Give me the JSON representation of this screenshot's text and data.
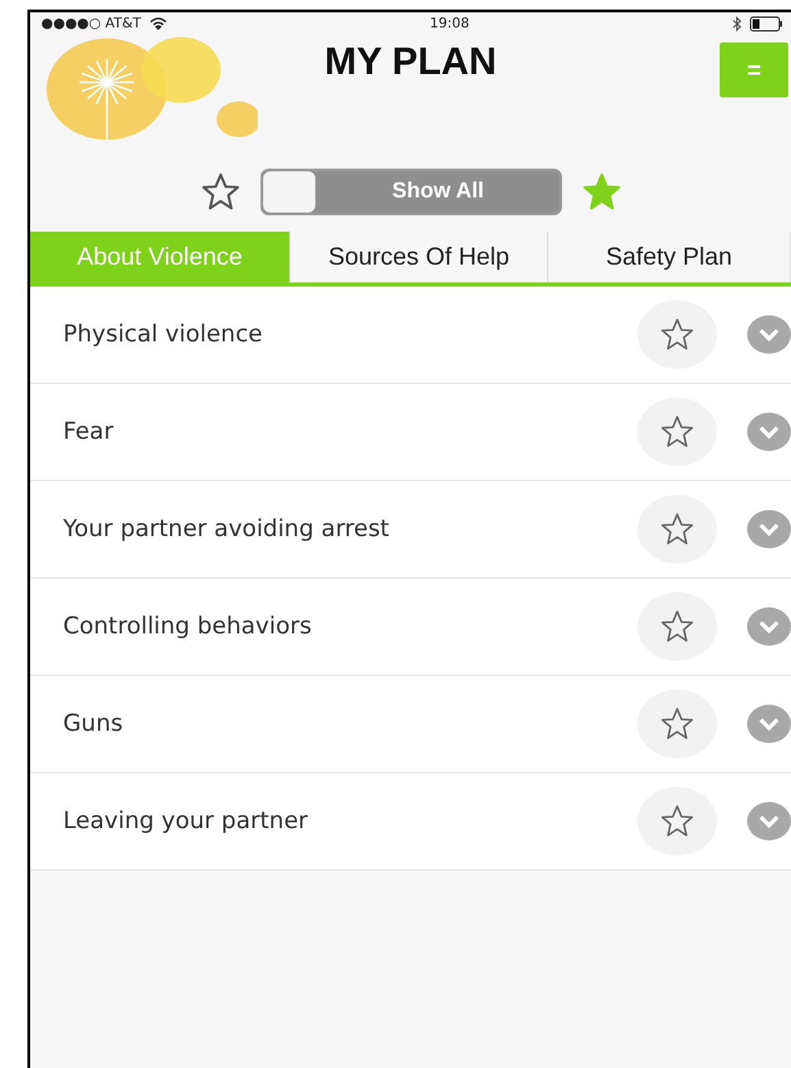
{
  "status_bar": {
    "carrier": "●●●●○ AT&T",
    "time": "19:08"
  },
  "header": {
    "title": "MY PLAN",
    "menu_button": "="
  },
  "filter": {
    "label": "Show All",
    "on": false
  },
  "tabs": [
    {
      "label": "About Violence",
      "selected": true
    },
    {
      "label": "Sources Of Help",
      "selected": false
    },
    {
      "label": "Safety Plan",
      "selected": false
    }
  ],
  "topics": [
    {
      "title": "Physical violence",
      "starred": false
    },
    {
      "title": "Fear",
      "starred": false
    },
    {
      "title": "Your partner avoiding arrest",
      "starred": false
    },
    {
      "title": "Controlling behaviors",
      "starred": false
    },
    {
      "title": "Guns",
      "starred": false
    },
    {
      "title": "Leaving your partner",
      "starred": false
    }
  ]
}
